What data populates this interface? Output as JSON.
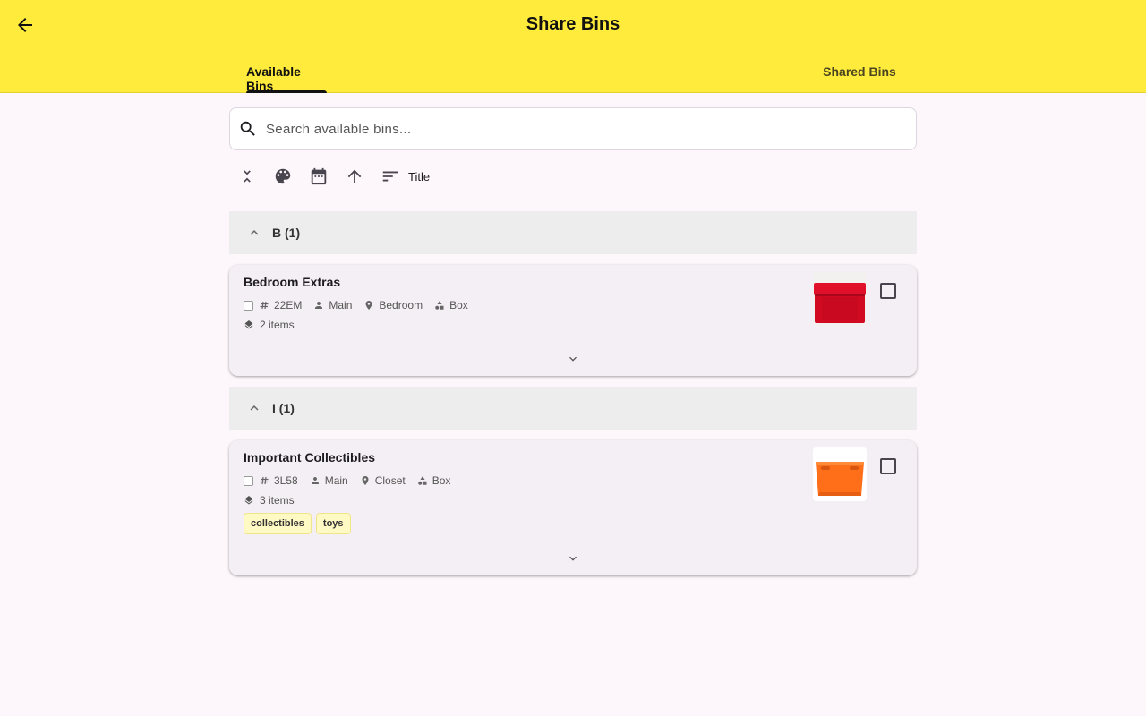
{
  "header": {
    "title": "Share Bins",
    "tabs": [
      {
        "label": "Available Bins",
        "active": true
      },
      {
        "label": "Shared Bins",
        "active": false
      }
    ]
  },
  "search": {
    "placeholder": "Search available bins...",
    "value": ""
  },
  "toolbar": {
    "sort_label": "Title",
    "icons": [
      "collapse-all-icon",
      "palette-icon",
      "calendar-icon",
      "arrow-up-icon",
      "sort-icon"
    ]
  },
  "groups": [
    {
      "label": "B (1)",
      "bins": [
        {
          "title": "Bedroom Extras",
          "code": "22EM",
          "owner": "Main",
          "location": "Bedroom",
          "type": "Box",
          "items": "2 items",
          "tags": [],
          "image_color": "#d81b2c"
        }
      ]
    },
    {
      "label": "I (1)",
      "bins": [
        {
          "title": "Important Collectibles",
          "code": "3L58",
          "owner": "Main",
          "location": "Closet",
          "type": "Box",
          "items": "3 items",
          "tags": [
            "collectibles",
            "toys"
          ],
          "image_color": "#ff7a1a"
        }
      ]
    }
  ],
  "colors": {
    "appbar": "#ffeb3b",
    "background": "#fdf7fc",
    "card": "#f4eff4",
    "group_header": "#ededed",
    "tag": "#fff9c4"
  }
}
